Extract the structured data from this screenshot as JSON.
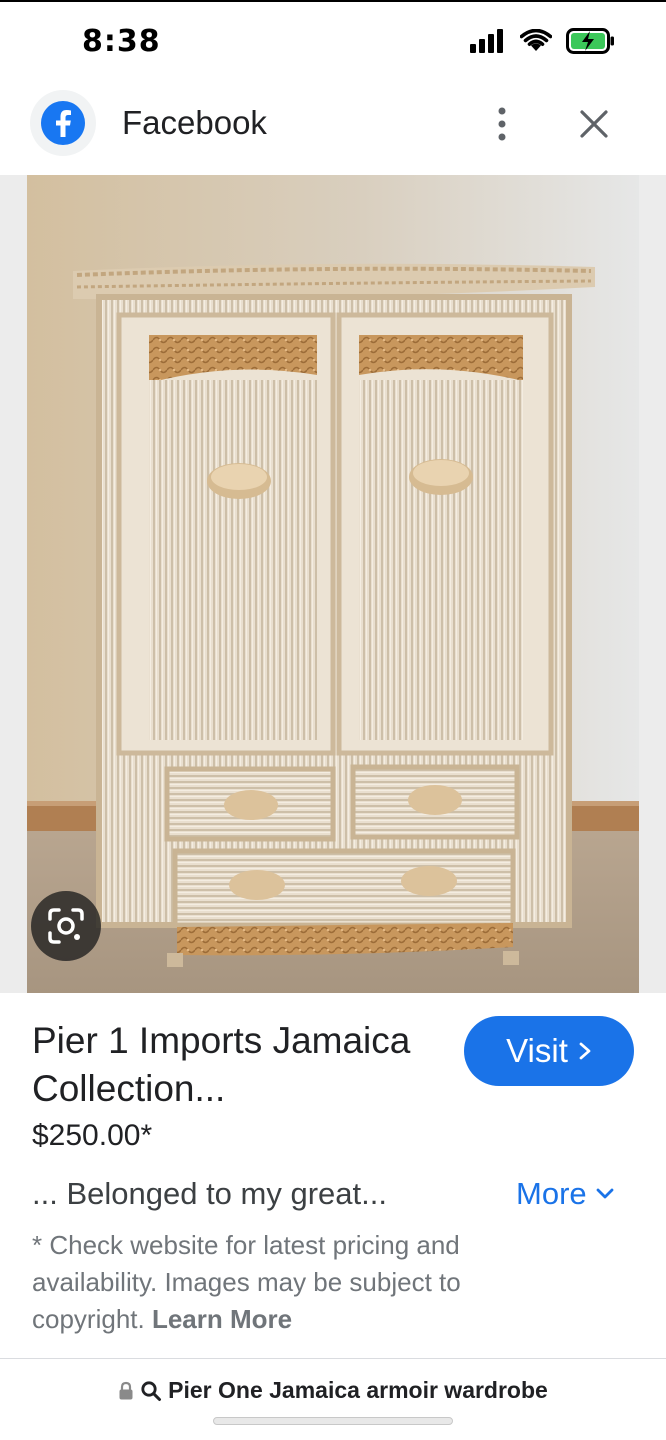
{
  "status_bar": {
    "time": "8:38"
  },
  "header": {
    "title": "Facebook",
    "logo_icon": "facebook-logo-icon",
    "menu_icon": "more-vertical-icon",
    "close_icon": "close-icon"
  },
  "image": {
    "alt": "Wicker armoire wardrobe",
    "lens_icon": "google-lens-icon"
  },
  "details": {
    "title": "Pier 1 Imports Jamaica Collection...",
    "visit_label": "Visit",
    "price": "$250.00*",
    "snippet": "... Belonged to my great...",
    "more_label": "More",
    "disclaimer": "* Check website for latest pricing and availability. Images may be subject to copyright.",
    "learn_more_label": "Learn More"
  },
  "url_bar": {
    "query": "Pier One Jamaica armoir wardrobe"
  },
  "colors": {
    "accent": "#1a73e8",
    "text_primary": "#202124",
    "text_secondary": "#70757a"
  }
}
